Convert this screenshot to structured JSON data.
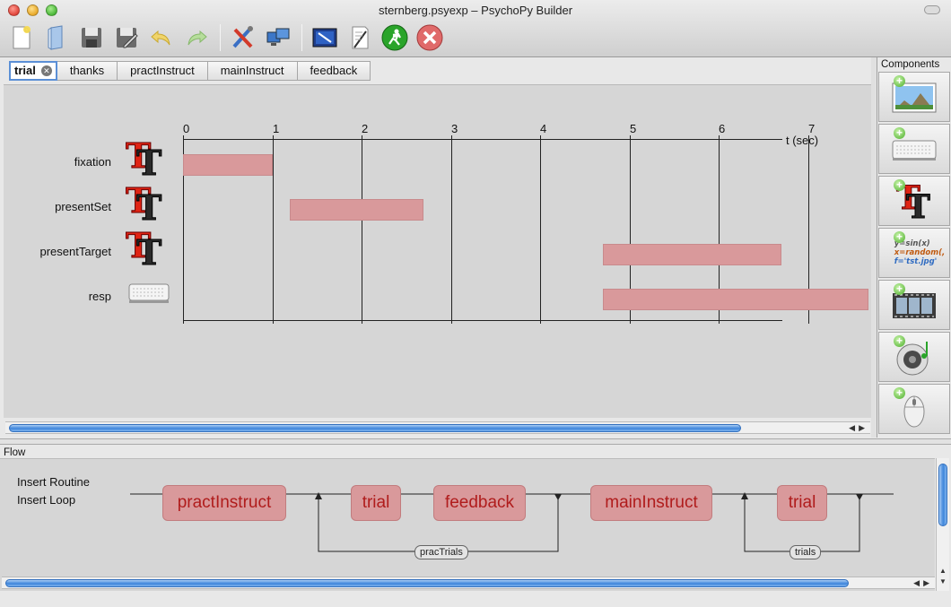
{
  "window": {
    "title": "sternberg.psyexp – PsychoPy Builder"
  },
  "toolbar": {
    "buttons": [
      {
        "name": "new-file-icon"
      },
      {
        "name": "open-file-icon"
      },
      {
        "name": "save-icon"
      },
      {
        "name": "save-as-icon"
      },
      {
        "name": "undo-icon"
      },
      {
        "name": "redo-icon"
      },
      {
        "name": "preferences-icon"
      },
      {
        "name": "monitor-center-icon"
      },
      {
        "name": "experiment-settings-icon"
      },
      {
        "name": "compile-script-icon"
      },
      {
        "name": "run-icon"
      },
      {
        "name": "stop-icon"
      }
    ]
  },
  "routine_tabs": [
    {
      "label": "trial",
      "active": true
    },
    {
      "label": "thanks"
    },
    {
      "label": "practInstruct"
    },
    {
      "label": "mainInstruct"
    },
    {
      "label": "feedback"
    }
  ],
  "timeline": {
    "ticks": [
      "0",
      "1",
      "2",
      "3",
      "4",
      "5",
      "6",
      "7"
    ],
    "axis_label": "t (sec)",
    "components": [
      {
        "name": "fixation",
        "icon": "text-component-icon",
        "start": 0,
        "stop": 1.0
      },
      {
        "name": "presentSet",
        "icon": "text-component-icon",
        "start": 1.2,
        "stop": 2.7
      },
      {
        "name": "presentTarget",
        "icon": "text-component-icon",
        "start": 4.7,
        "stop": 6.7
      },
      {
        "name": "resp",
        "icon": "keyboard-component-icon",
        "start": 4.7,
        "stop": 7.7
      }
    ]
  },
  "components_panel": {
    "title": "Components",
    "items": [
      {
        "name": "image-component-icon"
      },
      {
        "name": "keyboard-component-icon"
      },
      {
        "name": "text-component-icon"
      },
      {
        "name": "code-component-icon",
        "lines": [
          "y=sin(x)",
          "x=random(,",
          "f='tst.jpg'"
        ]
      },
      {
        "name": "movie-component-icon"
      },
      {
        "name": "sound-component-icon"
      },
      {
        "name": "mouse-component-icon"
      }
    ]
  },
  "flow": {
    "title": "Flow",
    "insert_routine": "Insert Routine",
    "insert_loop": "Insert Loop",
    "routines": [
      "practInstruct",
      "trial",
      "feedback",
      "mainInstruct",
      "trial"
    ],
    "loops": [
      "pracTrials",
      "trials"
    ]
  },
  "colors": {
    "routine_fill": "#d9999b",
    "routine_text": "#b01c1c",
    "scroll_thumb": "#3f86db"
  }
}
